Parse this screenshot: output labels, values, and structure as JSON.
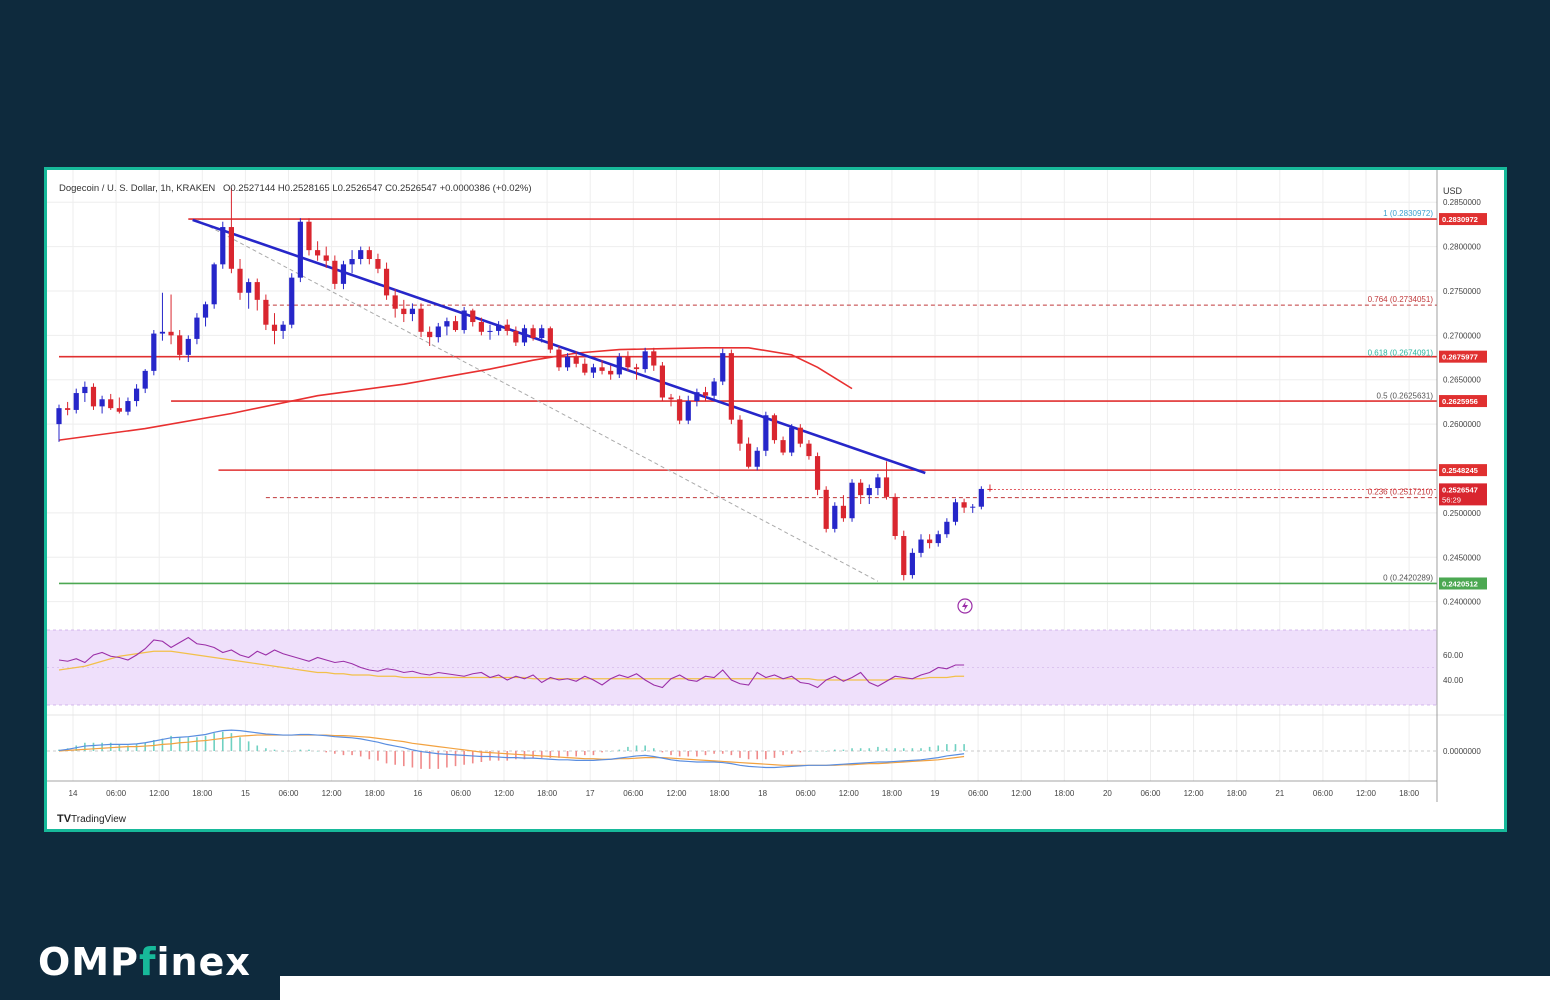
{
  "brand": {
    "logo_part1": "OMP",
    "logo_accent": "f",
    "logo_part2": "inex"
  },
  "footer": {
    "tradingview": "TradingView"
  },
  "chart_data": {
    "type": "candlestick",
    "title": "Dogecoin / U. S. Dollar, 1h, KRAKEN",
    "ohlc_header": "O0.2527144 H0.2528165 L0.2526547 C0.2526547 +0.0000386 (+0.02%)",
    "currency": "USD",
    "ylim": [
      0.2385,
      0.2875
    ],
    "y_ticks": [
      "0.2850000",
      "0.2800000",
      "0.2750000",
      "0.2700000",
      "0.2650000",
      "0.2600000",
      "0.2500000",
      "0.2450000",
      "0.2400000"
    ],
    "x_ticks": [
      "14",
      "06:00",
      "12:00",
      "18:00",
      "15",
      "06:00",
      "12:00",
      "18:00",
      "16",
      "06:00",
      "12:00",
      "18:00",
      "17",
      "06:00",
      "12:00",
      "18:00",
      "18",
      "06:00",
      "12:00",
      "18:00",
      "19",
      "06:00",
      "12:00",
      "18:00",
      "20",
      "06:00",
      "12:00",
      "18:00",
      "21",
      "06:00",
      "12:00",
      "18:00"
    ],
    "candles": [
      [
        0.26,
        0.2622,
        0.258,
        0.2618
      ],
      [
        0.2618,
        0.2625,
        0.261,
        0.2616
      ],
      [
        0.2616,
        0.264,
        0.2612,
        0.2635
      ],
      [
        0.2635,
        0.2648,
        0.2625,
        0.2642
      ],
      [
        0.2642,
        0.2646,
        0.2616,
        0.262
      ],
      [
        0.262,
        0.2632,
        0.2612,
        0.2628
      ],
      [
        0.2628,
        0.2634,
        0.2616,
        0.2618
      ],
      [
        0.2618,
        0.263,
        0.2612,
        0.2614
      ],
      [
        0.2614,
        0.263,
        0.261,
        0.2626
      ],
      [
        0.2626,
        0.2645,
        0.262,
        0.264
      ],
      [
        0.264,
        0.2662,
        0.2635,
        0.266
      ],
      [
        0.266,
        0.2706,
        0.2655,
        0.2702
      ],
      [
        0.2702,
        0.2748,
        0.2694,
        0.2704
      ],
      [
        0.2704,
        0.2746,
        0.269,
        0.27
      ],
      [
        0.27,
        0.2706,
        0.2672,
        0.2678
      ],
      [
        0.2678,
        0.27,
        0.267,
        0.2696
      ],
      [
        0.2696,
        0.2725,
        0.269,
        0.272
      ],
      [
        0.272,
        0.2738,
        0.271,
        0.2735
      ],
      [
        0.2735,
        0.2782,
        0.273,
        0.278
      ],
      [
        0.278,
        0.2828,
        0.2775,
        0.2822
      ],
      [
        0.2822,
        0.2866,
        0.277,
        0.2775
      ],
      [
        0.2775,
        0.2786,
        0.274,
        0.2748
      ],
      [
        0.2748,
        0.2764,
        0.273,
        0.276
      ],
      [
        0.276,
        0.2764,
        0.2728,
        0.274
      ],
      [
        0.274,
        0.2746,
        0.2706,
        0.2712
      ],
      [
        0.2712,
        0.2725,
        0.269,
        0.2705
      ],
      [
        0.2705,
        0.2716,
        0.2696,
        0.2712
      ],
      [
        0.2712,
        0.277,
        0.2708,
        0.2765
      ],
      [
        0.2765,
        0.2832,
        0.276,
        0.2828
      ],
      [
        0.2828,
        0.2832,
        0.279,
        0.2796
      ],
      [
        0.2796,
        0.2806,
        0.2784,
        0.279
      ],
      [
        0.279,
        0.28,
        0.2776,
        0.2784
      ],
      [
        0.2784,
        0.279,
        0.2752,
        0.2758
      ],
      [
        0.2758,
        0.2784,
        0.2752,
        0.278
      ],
      [
        0.278,
        0.2796,
        0.277,
        0.2786
      ],
      [
        0.2786,
        0.28,
        0.278,
        0.2796
      ],
      [
        0.2796,
        0.28,
        0.278,
        0.2786
      ],
      [
        0.2786,
        0.2792,
        0.277,
        0.2775
      ],
      [
        0.2775,
        0.2782,
        0.274,
        0.2745
      ],
      [
        0.2745,
        0.2752,
        0.272,
        0.273
      ],
      [
        0.273,
        0.274,
        0.2715,
        0.2724
      ],
      [
        0.2724,
        0.2736,
        0.2716,
        0.273
      ],
      [
        0.273,
        0.2736,
        0.2698,
        0.2704
      ],
      [
        0.2704,
        0.271,
        0.2688,
        0.2698
      ],
      [
        0.2698,
        0.2714,
        0.2692,
        0.271
      ],
      [
        0.271,
        0.272,
        0.27,
        0.2716
      ],
      [
        0.2716,
        0.2722,
        0.2704,
        0.2706
      ],
      [
        0.2706,
        0.2732,
        0.2702,
        0.2728
      ],
      [
        0.2728,
        0.273,
        0.271,
        0.2715
      ],
      [
        0.2715,
        0.272,
        0.27,
        0.2704
      ],
      [
        0.2704,
        0.2712,
        0.2695,
        0.2705
      ],
      [
        0.2705,
        0.2716,
        0.27,
        0.2712
      ],
      [
        0.2712,
        0.2718,
        0.27,
        0.2705
      ],
      [
        0.2705,
        0.271,
        0.2688,
        0.2692
      ],
      [
        0.2692,
        0.2712,
        0.2688,
        0.2708
      ],
      [
        0.2708,
        0.2712,
        0.2694,
        0.2697
      ],
      [
        0.2697,
        0.2712,
        0.2692,
        0.2708
      ],
      [
        0.2708,
        0.271,
        0.268,
        0.2684
      ],
      [
        0.2684,
        0.2688,
        0.266,
        0.2664
      ],
      [
        0.2664,
        0.268,
        0.266,
        0.2676
      ],
      [
        0.2676,
        0.2682,
        0.2664,
        0.2668
      ],
      [
        0.2668,
        0.2674,
        0.2655,
        0.2658
      ],
      [
        0.2658,
        0.2668,
        0.2652,
        0.2664
      ],
      [
        0.2664,
        0.2672,
        0.2656,
        0.266
      ],
      [
        0.266,
        0.2666,
        0.265,
        0.2656
      ],
      [
        0.2656,
        0.268,
        0.2652,
        0.2676
      ],
      [
        0.2676,
        0.2682,
        0.266,
        0.2664
      ],
      [
        0.2664,
        0.2668,
        0.265,
        0.2662
      ],
      [
        0.2662,
        0.2686,
        0.2658,
        0.2682
      ],
      [
        0.2682,
        0.2686,
        0.266,
        0.2666
      ],
      [
        0.2666,
        0.267,
        0.2626,
        0.263
      ],
      [
        0.263,
        0.2634,
        0.262,
        0.2628
      ],
      [
        0.2628,
        0.2632,
        0.26,
        0.2604
      ],
      [
        0.2604,
        0.2632,
        0.26,
        0.2626
      ],
      [
        0.2626,
        0.264,
        0.262,
        0.2636
      ],
      [
        0.2636,
        0.2642,
        0.2626,
        0.2632
      ],
      [
        0.2632,
        0.2652,
        0.2628,
        0.2648
      ],
      [
        0.2648,
        0.2685,
        0.2644,
        0.268
      ],
      [
        0.268,
        0.2684,
        0.26,
        0.2605
      ],
      [
        0.2605,
        0.261,
        0.257,
        0.2578
      ],
      [
        0.2578,
        0.2585,
        0.255,
        0.2552
      ],
      [
        0.2552,
        0.2574,
        0.2548,
        0.257
      ],
      [
        0.257,
        0.2614,
        0.2564,
        0.261
      ],
      [
        0.261,
        0.2612,
        0.2578,
        0.2582
      ],
      [
        0.2582,
        0.2586,
        0.2565,
        0.2568
      ],
      [
        0.2568,
        0.26,
        0.2564,
        0.2596
      ],
      [
        0.2596,
        0.26,
        0.2574,
        0.2578
      ],
      [
        0.2578,
        0.2582,
        0.256,
        0.2564
      ],
      [
        0.2564,
        0.2568,
        0.252,
        0.2526
      ],
      [
        0.2526,
        0.253,
        0.2478,
        0.2482
      ],
      [
        0.2482,
        0.2512,
        0.2478,
        0.2508
      ],
      [
        0.2508,
        0.252,
        0.249,
        0.2494
      ],
      [
        0.2494,
        0.2538,
        0.249,
        0.2534
      ],
      [
        0.2534,
        0.2538,
        0.251,
        0.252
      ],
      [
        0.252,
        0.2532,
        0.251,
        0.2528
      ],
      [
        0.2528,
        0.2544,
        0.252,
        0.254
      ],
      [
        0.254,
        0.2558,
        0.2515,
        0.2518
      ],
      [
        0.2518,
        0.2522,
        0.247,
        0.2474
      ],
      [
        0.2474,
        0.248,
        0.2424,
        0.243
      ],
      [
        0.243,
        0.246,
        0.2426,
        0.2455
      ],
      [
        0.2455,
        0.2476,
        0.245,
        0.247
      ],
      [
        0.247,
        0.2476,
        0.246,
        0.2466
      ],
      [
        0.2466,
        0.248,
        0.2462,
        0.2476
      ],
      [
        0.2476,
        0.2494,
        0.2472,
        0.249
      ],
      [
        0.249,
        0.2516,
        0.2486,
        0.2512
      ],
      [
        0.2512,
        0.2516,
        0.25,
        0.2506
      ],
      [
        0.2506,
        0.251,
        0.25,
        0.2507
      ],
      [
        0.2507,
        0.253,
        0.2504,
        0.2527
      ],
      [
        0.2527,
        0.2532,
        0.2524,
        0.2526
      ]
    ],
    "trendline": {
      "from": [
        15.5,
        0.283
      ],
      "to": [
        100.5,
        0.2545
      ]
    },
    "ma_curve": {
      "color": "#e83030",
      "points": [
        [
          0,
          0.2582
        ],
        [
          10,
          0.2595
        ],
        [
          20,
          0.2612
        ],
        [
          30,
          0.2632
        ],
        [
          40,
          0.2645
        ],
        [
          50,
          0.2662
        ],
        [
          55,
          0.2672
        ],
        [
          60,
          0.268
        ],
        [
          65,
          0.2684
        ],
        [
          70,
          0.2685
        ],
        [
          75,
          0.2686
        ],
        [
          80,
          0.2686
        ],
        [
          85,
          0.2678
        ],
        [
          88,
          0.2664
        ],
        [
          92,
          0.264
        ]
      ]
    },
    "dashed_channel": {
      "from": [
        16,
        0.283
      ],
      "to": [
        95,
        0.2423
      ]
    },
    "h_levels": [
      {
        "price": 0.2831,
        "from": 15,
        "label": "0.2830972",
        "color": "#e03030"
      },
      {
        "price": 0.2676,
        "from": 0,
        "label": "0.2675977",
        "color": "#e03030"
      },
      {
        "price": 0.2626,
        "from": 13,
        "label": "0.2625956",
        "color": "#e03030"
      },
      {
        "price": 0.25482,
        "from": 18.5,
        "label": "0.2548245",
        "color": "#e03030"
      },
      {
        "price": 0.24205,
        "from": 0,
        "label": "0.2420512",
        "color": "#4ca852"
      }
    ],
    "fib_levels": [
      {
        "price": 0.2830972,
        "label": "1 (0.2830972)",
        "color": "#3aa0d0",
        "dashed": false
      },
      {
        "price": 0.2734051,
        "label": "0.764 (0.2734051)",
        "color": "#c0393b",
        "dashed": true
      },
      {
        "price": 0.2674091,
        "label": "0.618 (0.2674091)",
        "color": "#2bb5a0",
        "dashed": false
      },
      {
        "price": 0.2625631,
        "label": "0.5 (0.2625631)",
        "color": "#555555",
        "dashed": false
      },
      {
        "price": 0.251721,
        "label": "0.236 (0.2517210)",
        "color": "#c0393b",
        "dashed": true
      },
      {
        "price": 0.2420289,
        "label": "0 (0.2420289)",
        "color": "#555555",
        "dashed": false
      }
    ],
    "last_price": {
      "value": "0.2526547",
      "countdown": "56:29",
      "price": 0.25265
    },
    "rsi": {
      "ticks": [
        "60.00",
        "40.00"
      ],
      "values": [
        56,
        55,
        57,
        54,
        60,
        62,
        59,
        58,
        56,
        60,
        65,
        72,
        71,
        66,
        70,
        74,
        69,
        68,
        66,
        62,
        64,
        60,
        58,
        63,
        60,
        64,
        61,
        59,
        57,
        55,
        58,
        56,
        54,
        55,
        53,
        50,
        48,
        47,
        49,
        48,
        46,
        47,
        45,
        44,
        46,
        45,
        44,
        43,
        45,
        46,
        42,
        44,
        40,
        43,
        41,
        44,
        38,
        42,
        40,
        41,
        39,
        43,
        40,
        36,
        41,
        44,
        42,
        45,
        40,
        36,
        34,
        41,
        44,
        40,
        39,
        43,
        42,
        48,
        40,
        37,
        36,
        46,
        42,
        44,
        41,
        43,
        38,
        37,
        34,
        40,
        43,
        39,
        42,
        46,
        38,
        35,
        39,
        43,
        42,
        41,
        44,
        46,
        50,
        49,
        52,
        52
      ],
      "ma": [
        48,
        49,
        50,
        51,
        53,
        55,
        57,
        59,
        60,
        61,
        62,
        63,
        63,
        63,
        62,
        61,
        60,
        59,
        58,
        57,
        56,
        55,
        54,
        53,
        52,
        51,
        50,
        49,
        48,
        47,
        46,
        46,
        45,
        45,
        44,
        44,
        44,
        43,
        43,
        43,
        42,
        42,
        42,
        42,
        42,
        42,
        42,
        42,
        42,
        42,
        42,
        42,
        42,
        42,
        42,
        41,
        41,
        41,
        41,
        41,
        41,
        41,
        41,
        41,
        41,
        41,
        41,
        41,
        41,
        41,
        41,
        41,
        41,
        41,
        41,
        41,
        41,
        41,
        41,
        41,
        41,
        41,
        41,
        41,
        41,
        41,
        41,
        41,
        40,
        40,
        40,
        40,
        40,
        40,
        40,
        40,
        40,
        41,
        41,
        41,
        41,
        42,
        42,
        42,
        43,
        43
      ]
    },
    "macd": {
      "tick": "0.0000000",
      "macd": [
        0.0001,
        0.0003,
        0.0006,
        0.0009,
        0.001,
        0.0011,
        0.0012,
        0.0012,
        0.0012,
        0.0013,
        0.0015,
        0.0018,
        0.0021,
        0.0024,
        0.0025,
        0.0026,
        0.0028,
        0.003,
        0.0034,
        0.0037,
        0.0038,
        0.0037,
        0.0035,
        0.0033,
        0.0031,
        0.003,
        0.0029,
        0.0029,
        0.003,
        0.003,
        0.0029,
        0.0028,
        0.0026,
        0.0025,
        0.0024,
        0.0022,
        0.0019,
        0.0016,
        0.0012,
        0.0009,
        0.0006,
        0.0002,
        -0.0001,
        -0.0003,
        -0.0005,
        -0.0006,
        -0.0007,
        -0.0008,
        -0.0009,
        -0.001,
        -0.001,
        -0.0011,
        -0.0012,
        -0.0012,
        -0.0013,
        -0.0013,
        -0.0014,
        -0.0015,
        -0.0016,
        -0.0016,
        -0.0017,
        -0.0017,
        -0.0017,
        -0.0016,
        -0.0015,
        -0.0013,
        -0.0011,
        -0.0009,
        -0.0008,
        -0.001,
        -0.0013,
        -0.0016,
        -0.0018,
        -0.0019,
        -0.002,
        -0.002,
        -0.002,
        -0.0021,
        -0.0023,
        -0.0026,
        -0.0028,
        -0.0029,
        -0.003,
        -0.003,
        -0.0029,
        -0.0028,
        -0.0027,
        -0.0026,
        -0.0026,
        -0.0026,
        -0.0025,
        -0.0024,
        -0.0023,
        -0.0022,
        -0.0021,
        -0.002,
        -0.002,
        -0.0019,
        -0.0018,
        -0.0017,
        -0.0016,
        -0.0014,
        -0.0012,
        -0.0009,
        -0.0007,
        -0.0005
      ],
      "signal": [
        0.0,
        0.0001,
        0.0002,
        0.0003,
        0.0004,
        0.0005,
        0.0006,
        0.0007,
        0.0008,
        0.0008,
        0.0009,
        0.001,
        0.0012,
        0.0013,
        0.0015,
        0.0016,
        0.0018,
        0.0019,
        0.0021,
        0.0023,
        0.0025,
        0.0027,
        0.0028,
        0.0029,
        0.0029,
        0.0029,
        0.0029,
        0.0029,
        0.0029,
        0.0029,
        0.0029,
        0.0029,
        0.0028,
        0.0028,
        0.0027,
        0.0026,
        0.0025,
        0.0023,
        0.0021,
        0.0019,
        0.0017,
        0.0014,
        0.0012,
        0.001,
        0.0008,
        0.0006,
        0.0004,
        0.0002,
        0.0,
        -0.0002,
        -0.0003,
        -0.0004,
        -0.0005,
        -0.0006,
        -0.0007,
        -0.0008,
        -0.0009,
        -0.001,
        -0.0011,
        -0.0012,
        -0.0013,
        -0.0014,
        -0.0014,
        -0.0015,
        -0.0015,
        -0.0014,
        -0.0014,
        -0.0013,
        -0.0012,
        -0.0012,
        -0.0012,
        -0.0013,
        -0.0014,
        -0.0015,
        -0.0016,
        -0.0017,
        -0.0018,
        -0.0019,
        -0.002,
        -0.0021,
        -0.0022,
        -0.0023,
        -0.0024,
        -0.0025,
        -0.0026,
        -0.0026,
        -0.0026,
        -0.0026,
        -0.0026,
        -0.0026,
        -0.0026,
        -0.0025,
        -0.0025,
        -0.0024,
        -0.0023,
        -0.0023,
        -0.0022,
        -0.0021,
        -0.002,
        -0.0019,
        -0.0018,
        -0.0017,
        -0.0016,
        -0.0014,
        -0.0012,
        -0.001
      ]
    },
    "colors": {
      "up": "#2626c9",
      "down": "#d9262f",
      "trendline": "#2626c9",
      "rsi": "#9b2fa8",
      "rsi_ma": "#f2c04a",
      "macd": "#5a8ee0",
      "signal": "#f2a240",
      "rsi_band": "#efe0fb",
      "frame": "#17b99a"
    }
  }
}
